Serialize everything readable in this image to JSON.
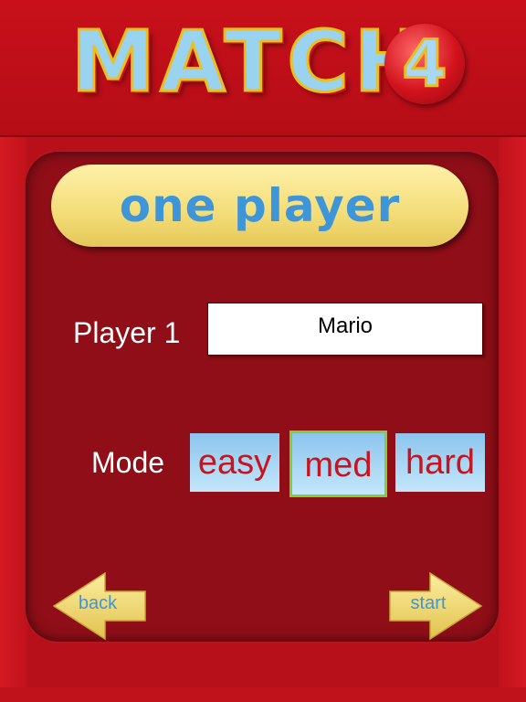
{
  "logo": {
    "letters": "MATCH",
    "number": "4"
  },
  "title": "one player",
  "player": {
    "label": "Player 1",
    "name_value": "Mario"
  },
  "mode": {
    "label": "Mode",
    "options": [
      {
        "label": "easy",
        "selected": false
      },
      {
        "label": "med",
        "selected": true
      },
      {
        "label": "hard",
        "selected": false
      }
    ],
    "selected_outline_color": "#7ad23a"
  },
  "nav": {
    "back_label": "back",
    "start_label": "start"
  },
  "colors": {
    "background": "#b8101a",
    "panel": "#8f0e17",
    "title_pill": "#f3dd78",
    "title_text": "#3e95d8",
    "mode_button": "#a8d6f4",
    "mode_text": "#c8141e",
    "arrow": "#f0d870"
  },
  "icons": {
    "back": "arrow-left-icon",
    "start": "arrow-right-icon"
  }
}
